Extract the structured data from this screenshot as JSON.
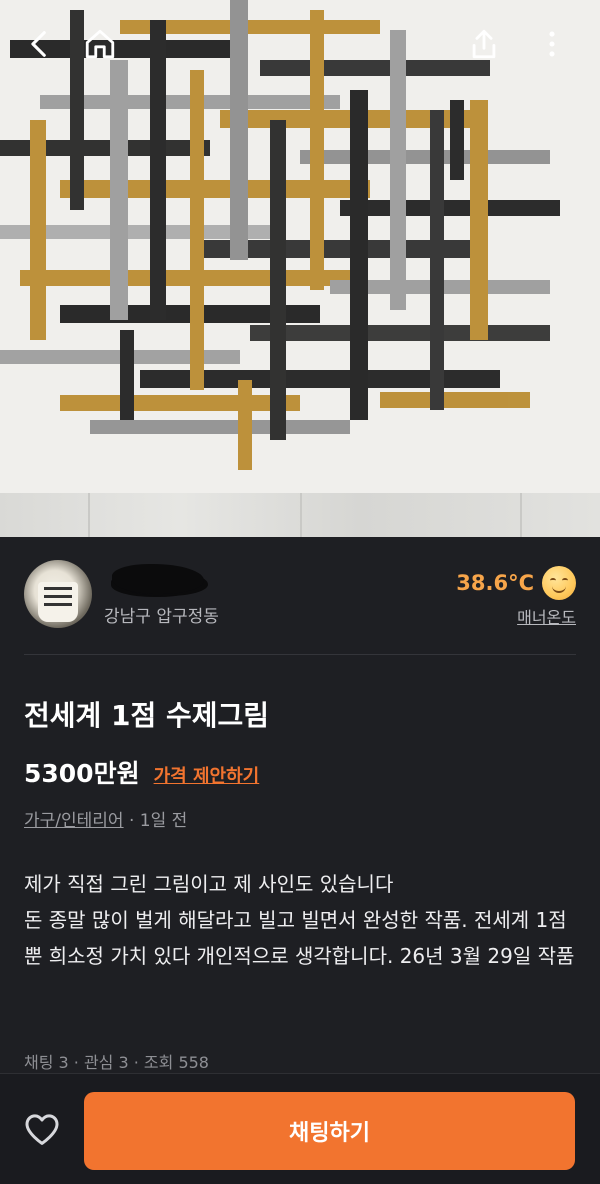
{
  "seller": {
    "location": "강남구 압구정동",
    "temperature": "38.6°C",
    "manner_label": "매너온도",
    "avatar_icon": "cup-avatar",
    "temp_icon": "smiling-face-icon"
  },
  "listing": {
    "title": "전세계 1점 수제그림",
    "price": "5300만원",
    "offer_label": "가격 제안하기",
    "category": "가구/인테리어",
    "time": "· 1일 전",
    "description": "제가 직접 그린 그림이고 제 사인도 있습니다\n돈 종말 많이 벌게 해달라고 빌고 빌면서 완성한 작품. 전세계 1점 뿐 희소정 가치 있다 개인적으로 생각합니다. 26년 3월 29일 작품",
    "stats": "채팅 3 · 관심 3 · 조회 558"
  },
  "actions": {
    "chat_label": "채팅하기"
  },
  "colors": {
    "accent": "#f2742f",
    "temperature": "#f7a54a",
    "background": "#1e1f23"
  }
}
